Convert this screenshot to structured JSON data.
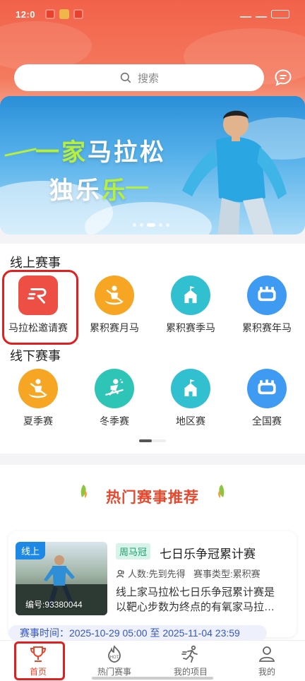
{
  "status_bar": {
    "time": "12:0",
    "battery": ""
  },
  "search": {
    "placeholder": "搜索"
  },
  "banner": {
    "line1_prefix": "一家",
    "line1_main": "马拉松",
    "line2_main": "独乐",
    "line2_accent": "乐"
  },
  "online_section": {
    "title": "线上赛事",
    "items": [
      {
        "label": "马拉松邀请赛",
        "icon": "runner-logo-icon"
      },
      {
        "label": "累积赛月马",
        "icon": "rowing-icon"
      },
      {
        "label": "累积赛季马",
        "icon": "school-icon"
      },
      {
        "label": "累积赛年马",
        "icon": "stadium-icon"
      }
    ]
  },
  "offline_section": {
    "title": "线下赛事",
    "items": [
      {
        "label": "夏季赛",
        "icon": "rowing-icon"
      },
      {
        "label": "冬季赛",
        "icon": "skiing-icon"
      },
      {
        "label": "地区赛",
        "icon": "school-icon"
      },
      {
        "label": "全国赛",
        "icon": "stadium-icon"
      }
    ]
  },
  "hot": {
    "title": "热门赛事推荐",
    "event": {
      "online_tag": "线上",
      "number": "编号:93380044",
      "type_tag": "周马冠",
      "title": "七日乐争冠累计赛",
      "people": "人数:先到先得",
      "category": "赛事类型:累积赛",
      "description": "线上家马拉松七日乐争冠累计赛是以靶心步数为终点的有氧家马拉…",
      "time": "赛事时间：2025-10-29 05:00 至 2025-11-04 23:59"
    }
  },
  "tabs": [
    {
      "label": "首页",
      "icon": "trophy-icon",
      "active": true
    },
    {
      "label": "热门赛事",
      "icon": "hot-icon",
      "active": false
    },
    {
      "label": "我的项目",
      "icon": "running-person-icon",
      "active": false
    },
    {
      "label": "我的",
      "icon": "user-icon",
      "active": false
    }
  ],
  "colors": {
    "accent": "#e8472c",
    "header": "#f2624a",
    "highlight": "#e02020"
  }
}
